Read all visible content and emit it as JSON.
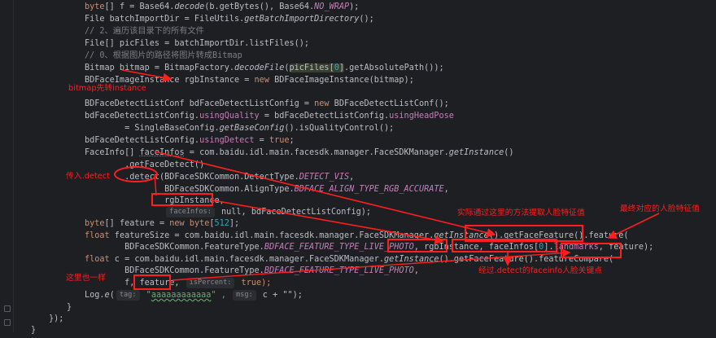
{
  "code": {
    "l1": {
      "a": "byte",
      "b": "[] f = Base64.",
      "c": "decode",
      "d": "(b.getBytes(), Base64.",
      "e": "NO_WRAP",
      "f": ");"
    },
    "l2": {
      "a": "File batchImportDir = FileUtils.",
      "b": "getBatchImportDirectory",
      "c": "();"
    },
    "l3": {
      "a": "// 2、遍历该目录下的所有文件"
    },
    "l4": {
      "a": "File[] picFiles = batchImportDir.listFiles();"
    },
    "l5": {
      "a": "// 0、根据图片的路径将图片转成Bitmap"
    },
    "l6": {
      "a": "Bitmap bitmap = BitmapFactory.",
      "b": "decodeFile",
      "c": "(",
      "d": "picFiles[",
      "e": "0",
      "f": "]",
      "g": ".getAbsolutePath());"
    },
    "l7": {
      "a": "BDFaceImageInstance rgbInstance = ",
      "b": "new",
      "c": " BDFaceImageInstance(bitmap);"
    },
    "l8": {
      "a": "BDFaceDetectListConf bdFaceDetectListConfig = ",
      "b": "new",
      "c": " BDFaceDetectListConf();"
    },
    "l9": {
      "a": "bdFaceDetectListConfig.",
      "b": "usingQuality",
      "c": " = bdFaceDetectListConfig.",
      "d": "usingHeadPose"
    },
    "l10": {
      "a": "        = SingleBaseConfig.",
      "b": "getBaseConfig",
      "c": "().isQualityControl();"
    },
    "l11": {
      "a": "bdFaceDetectListConfig.",
      "b": "usingDetect",
      "c": " = ",
      "d": "true",
      "e": ";"
    },
    "l12": {
      "a": "FaceInfo[] ",
      "b": "faceInfos",
      "c": " = com.baidu.idl.main.facesdk.manager.FaceSDKManager.",
      "d": "getInstance",
      "e": "()"
    },
    "l13": {
      "a": "        .getFaceDetect()"
    },
    "l14": {
      "a": "        .detect(BDFaceSDKCommon.DetectType.",
      "b": "DETECT_VIS",
      "c": ","
    },
    "l15": {
      "a": "                BDFaceSDKCommon.AlignType.",
      "b": "BDFACE_ALIGN_TYPE_RGB_ACCURATE",
      "c": ","
    },
    "l16": {
      "a": "                rgbInstance,"
    },
    "l17": {
      "a": "                ",
      "hint": "faceInfos:",
      "b": " null, bdFaceDetectListConfig);"
    },
    "l18": {
      "a": "byte",
      "b": "[] feature = ",
      "c": "new",
      "d": " byte",
      "e": "[",
      "f": "512",
      "g": "];"
    },
    "l19": {
      "a": "float",
      "b": " featureSize = com.baidu.idl.main.facesdk.manager.FaceSDKManager.",
      "c": "getInstance",
      "d": "().getFaceFeature().feature("
    },
    "l20": {
      "a": "        BDFaceSDKCommon.FeatureType.",
      "b": "BDFACE_FEATURE_TYPE_LIVE_PHOTO",
      "c": ", rgbInstance, faceInfos[",
      "d": "0",
      "e": "].",
      "f": "landmarks",
      "g": ", feature);"
    },
    "l21": {
      "a": "float",
      "b": " c = com.baidu.idl.main.facesdk.manager.FaceSDKManager.",
      "c": "getInstance",
      "d": "().getFaceFeature().featureCompare("
    },
    "l22": {
      "a": "        BDFaceSDKCommon.FeatureType.",
      "b": "BDFACE_FEATURE_TYPE_LIVE_PHOTO",
      "c": ","
    },
    "l23": {
      "a": "        f, feature, ",
      "hint": "isPercent:",
      "b": " true);"
    },
    "l24": {
      "a": "Log.",
      "b": "e",
      "c": "(",
      "hint1": "tag:",
      "d": " \"",
      "e": "aaaaaaaaaaaa",
      "f": "\" , ",
      "hint2": "msg:",
      "g": " c + \"\");"
    },
    "l25": {
      "a": "}"
    },
    "l26": {
      "a": "});"
    },
    "l27": {
      "a": "}"
    }
  },
  "annotations": {
    "bitmap_to_instance": "bitmap先转instance",
    "pass_detect": "传入.detect",
    "actual_method": "实际通过这里的方法提取人脸特征值",
    "final_feature": "最终对应的人脸特征值",
    "same_here": "这里也一样",
    "detect_keypoints": "经过.detect的faceinfo人脸关键点"
  },
  "colors": {
    "background": "#1e1f22",
    "annotation": "#ff1f1f",
    "keyword": "#cf8e6d",
    "string": "#6aab73",
    "number": "#2aacb8",
    "field": "#c77dbb",
    "comment": "#7a7e85"
  }
}
